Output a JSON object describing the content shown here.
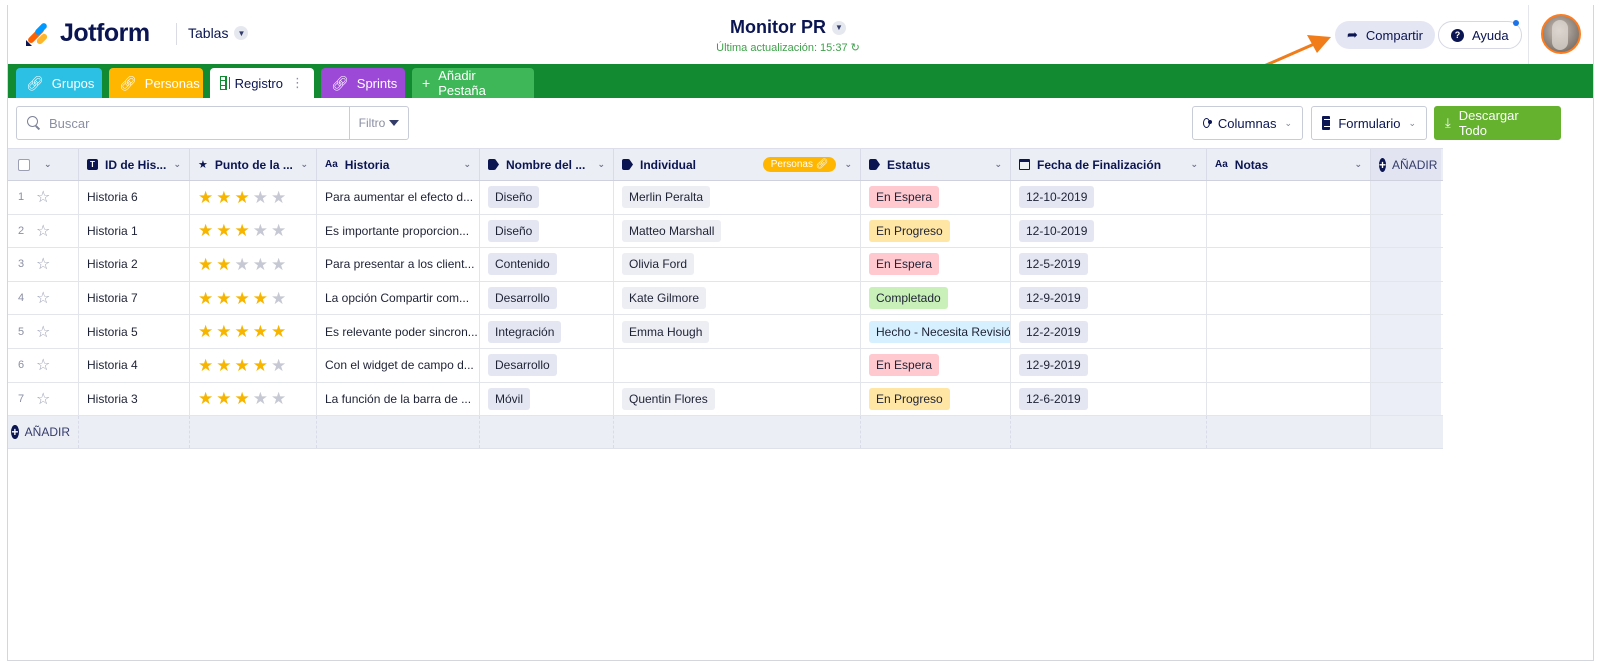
{
  "header": {
    "brand": "Jotform",
    "tables_label": "Tablas",
    "title": "Monitor PR",
    "subtitle": "Última actualización: 15:37",
    "share_label": "Compartir",
    "help_label": "Ayuda"
  },
  "tabs": [
    {
      "label": "Grupos",
      "color": "#2bc0e4",
      "icon": "link-icon"
    },
    {
      "label": "Personas",
      "color": "#ffb600",
      "icon": "link-icon"
    },
    {
      "label": "Registro",
      "color": "#ffffff",
      "icon": "grid-icon"
    },
    {
      "label": "Sprints",
      "color": "#9d49d8",
      "icon": "link-icon"
    },
    {
      "label": "Añadir Pestaña",
      "color": "#3eb759",
      "icon": "plus-icon"
    }
  ],
  "toolbar": {
    "search_placeholder": "Buscar",
    "filter_label": "Filtro",
    "columns_label": "Columnas",
    "form_label": "Formulario",
    "download_label": "Descargar Todo"
  },
  "table": {
    "columns": [
      "ID de His...",
      "Punto de la ...",
      "Historia",
      "Nombre del ...",
      "Individual",
      "Estatus",
      "Fecha de Finalización",
      "Notas"
    ],
    "personas_badge": "Personas",
    "add_column_label": "AÑADIR",
    "add_row_label": "AÑADIR",
    "rows": [
      {
        "n": "1",
        "id": "Historia 6",
        "rating": 3,
        "historia": "Para aumentar el efecto d...",
        "nombre": "Diseño",
        "individual": "Merlin Peralta",
        "estatus": "En Espera",
        "fecha": "12-10-2019"
      },
      {
        "n": "2",
        "id": "Historia 1",
        "rating": 3,
        "historia": "Es importante proporcion...",
        "nombre": "Diseño",
        "individual": "Matteo Marshall",
        "estatus": "En Progreso",
        "fecha": "12-10-2019"
      },
      {
        "n": "3",
        "id": "Historia 2",
        "rating": 2,
        "historia": "Para presentar a los client...",
        "nombre": "Contenido",
        "individual": "Olivia Ford",
        "estatus": "En Espera",
        "fecha": "12-5-2019"
      },
      {
        "n": "4",
        "id": "Historia 7",
        "rating": 4,
        "historia": "La opción Compartir com...",
        "nombre": "Desarrollo",
        "individual": "Kate Gilmore",
        "estatus": "Completado",
        "fecha": "12-9-2019"
      },
      {
        "n": "5",
        "id": "Historia 5",
        "rating": 5,
        "historia": "Es relevante poder sincron...",
        "nombre": "Integración",
        "individual": "Emma Hough",
        "estatus": "Hecho - Necesita Revisió",
        "fecha": "12-2-2019"
      },
      {
        "n": "6",
        "id": "Historia 4",
        "rating": 4,
        "historia": "Con el widget de campo d...",
        "nombre": "Desarrollo",
        "individual": "",
        "estatus": "En Espera",
        "fecha": "12-9-2019"
      },
      {
        "n": "7",
        "id": "Historia 3",
        "rating": 3,
        "historia": "La función de la barra de ...",
        "nombre": "Móvil",
        "individual": "Quentin Flores",
        "estatus": "En Progreso",
        "fecha": "12-6-2019"
      }
    ]
  },
  "status_colors": {
    "En Espera": "#ffc9cf",
    "En Progreso": "#ffe6a4",
    "Completado": "#c9f0b8",
    "Hecho - Necesita Revisió": "#d6f0ff"
  },
  "colors": {
    "tabbar": "#128a31",
    "download_button": "#64b22d",
    "star": "#f7b500",
    "annotation_arrow": "#f07c1a"
  }
}
